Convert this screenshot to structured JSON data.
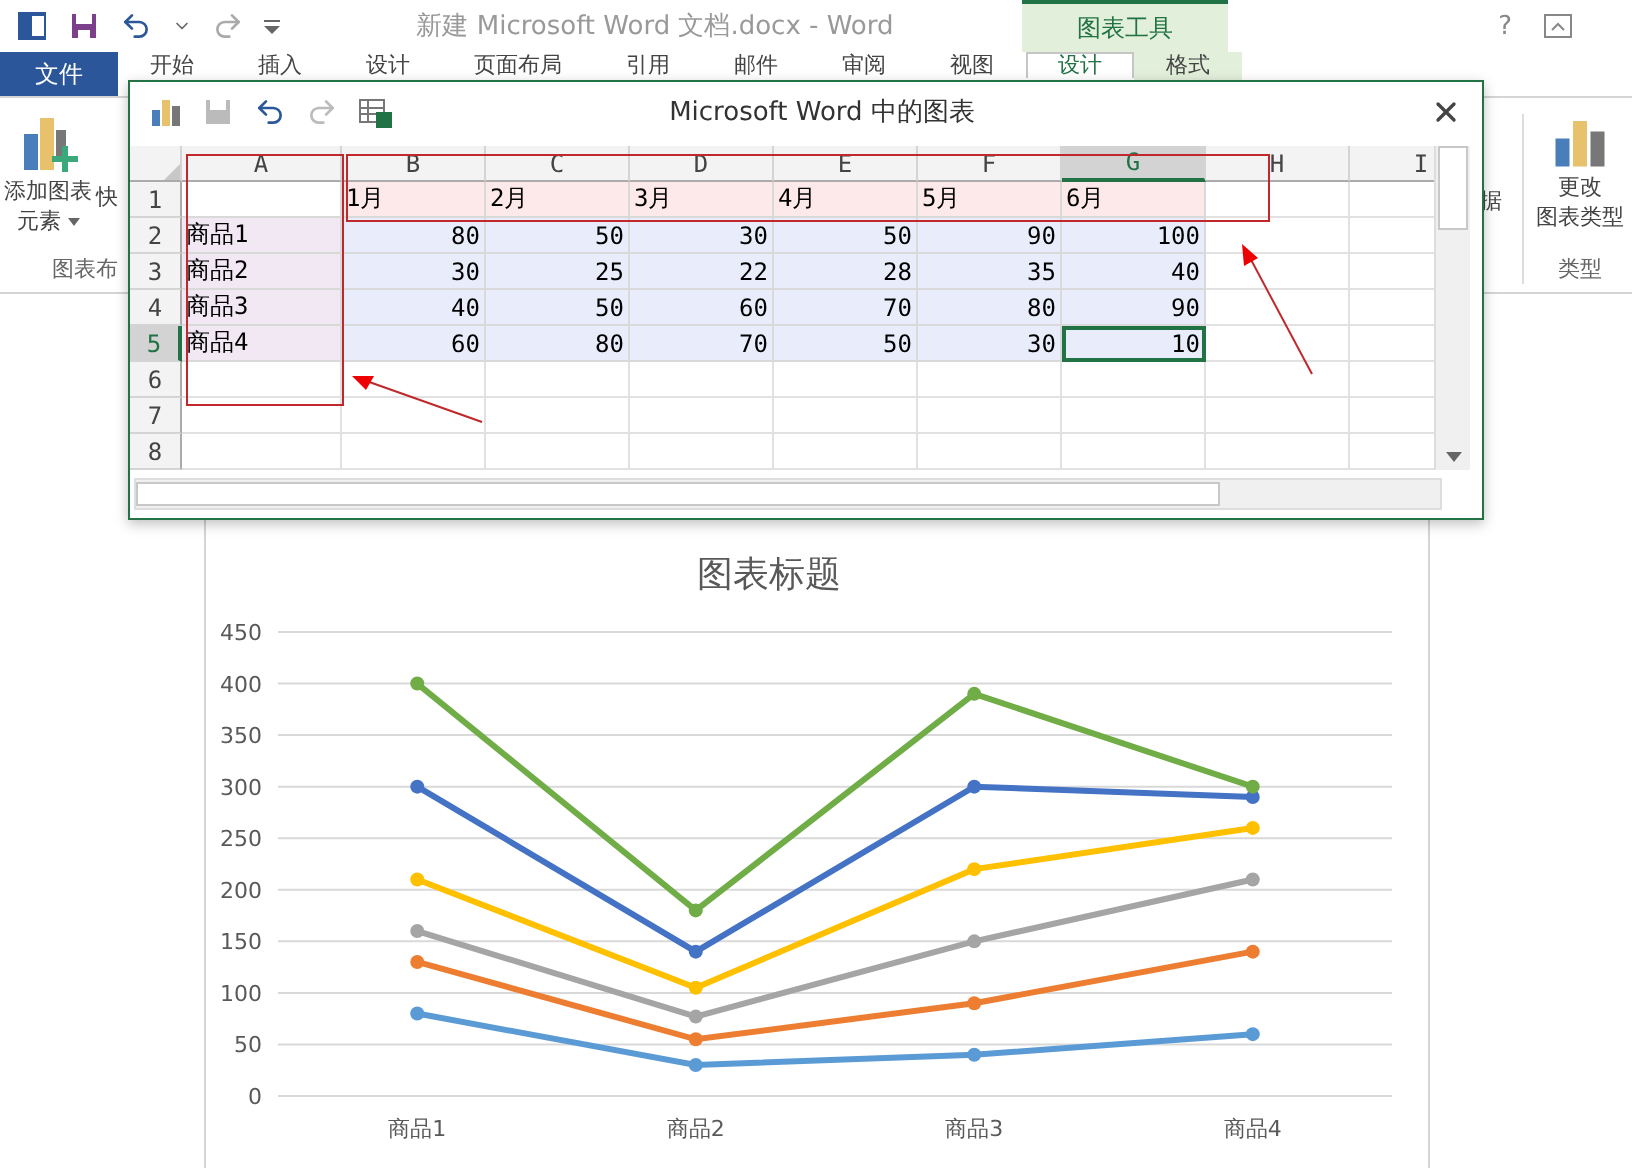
{
  "title_bar": {
    "title": "新建 Microsoft Word 文档.docx - Word",
    "tool_group": "图表工具",
    "help": "?"
  },
  "ribbon_tabs": [
    {
      "label": "文件",
      "kind": "file",
      "selected": false
    },
    {
      "label": "开始",
      "kind": "tab",
      "selected": false
    },
    {
      "label": "插入",
      "kind": "tab",
      "selected": false
    },
    {
      "label": "设计",
      "kind": "tab",
      "selected": false
    },
    {
      "label": "页面布局",
      "kind": "tab",
      "selected": false
    },
    {
      "label": "引用",
      "kind": "tab",
      "selected": false
    },
    {
      "label": "邮件",
      "kind": "tab",
      "selected": false
    },
    {
      "label": "审阅",
      "kind": "tab",
      "selected": false
    },
    {
      "label": "视图",
      "kind": "tab",
      "selected": false
    },
    {
      "label": "设计",
      "kind": "tool",
      "selected": true
    },
    {
      "label": "格式",
      "kind": "tool",
      "selected": false
    }
  ],
  "ribbon_left": {
    "button": [
      "添加图表",
      "元素"
    ],
    "cut_button": "快",
    "group": "图表布"
  },
  "ribbon_right": {
    "cut_label": "据",
    "button": [
      "更改",
      "图表类型"
    ],
    "group": "类型"
  },
  "data_window": {
    "title": "Microsoft Word 中的图表",
    "columns": [
      {
        "label": "A",
        "selected": false
      },
      {
        "label": "B",
        "selected": false
      },
      {
        "label": "C",
        "selected": false
      },
      {
        "label": "D",
        "selected": false
      },
      {
        "label": "E",
        "selected": false
      },
      {
        "label": "F",
        "selected": false
      },
      {
        "label": "G",
        "selected": true
      },
      {
        "label": "H",
        "selected": false
      },
      {
        "label": "I",
        "selected": false
      }
    ],
    "rows": [
      {
        "number": "1",
        "selected": false,
        "cells": [
          {
            "selected": false
          },
          {
            "text": "1月",
            "selected": false
          },
          {
            "text": "2月",
            "selected": false
          },
          {
            "text": "3月",
            "selected": false
          },
          {
            "text": "4月",
            "selected": false
          },
          {
            "text": "5月",
            "selected": false
          },
          {
            "text": "6月",
            "selected": false
          }
        ]
      },
      {
        "number": "2",
        "selected": false,
        "cells": [
          {
            "text": "商品1",
            "selected": false
          },
          {
            "text": "80",
            "selected": false
          },
          {
            "text": "50",
            "selected": false
          },
          {
            "text": "30",
            "selected": false
          },
          {
            "text": "50",
            "selected": false
          },
          {
            "text": "90",
            "selected": false
          },
          {
            "text": "100",
            "selected": false
          }
        ]
      },
      {
        "number": "3",
        "selected": false,
        "cells": [
          {
            "text": "商品2",
            "selected": false
          },
          {
            "text": "30",
            "selected": false
          },
          {
            "text": "25",
            "selected": false
          },
          {
            "text": "22",
            "selected": false
          },
          {
            "text": "28",
            "selected": false
          },
          {
            "text": "35",
            "selected": false
          },
          {
            "text": "40",
            "selected": false
          }
        ]
      },
      {
        "number": "4",
        "selected": false,
        "cells": [
          {
            "text": "商品3",
            "selected": false
          },
          {
            "text": "40",
            "selected": false
          },
          {
            "text": "50",
            "selected": false
          },
          {
            "text": "60",
            "selected": false
          },
          {
            "text": "70",
            "selected": false
          },
          {
            "text": "80",
            "selected": false
          },
          {
            "text": "90",
            "selected": false
          }
        ]
      },
      {
        "number": "5",
        "selected": true,
        "cells": [
          {
            "text": "商品4",
            "selected": false
          },
          {
            "text": "60",
            "selected": false
          },
          {
            "text": "80",
            "selected": false
          },
          {
            "text": "70",
            "selected": false
          },
          {
            "text": "50",
            "selected": false
          },
          {
            "text": "30",
            "selected": false
          },
          {
            "text": "10",
            "selected": true
          }
        ]
      },
      {
        "number": "6",
        "selected": false
      },
      {
        "number": "7",
        "selected": false
      },
      {
        "number": "8",
        "selected": false
      }
    ]
  },
  "chart": {
    "chart_data": {
      "type": "line",
      "title": "图表标题",
      "grid": true,
      "categories": [
        "商品1",
        "商品2",
        "商品3",
        "商品4"
      ],
      "series": [
        {
          "color": "#5b9bd5",
          "marker": "circle",
          "values": [
            80,
            30,
            40,
            60
          ]
        },
        {
          "color": "#ed7d31",
          "marker": "circle",
          "values": [
            130,
            55,
            90,
            140
          ]
        },
        {
          "color": "#a5a5a5",
          "marker": "circle",
          "values": [
            160,
            77,
            150,
            210
          ]
        },
        {
          "color": "#ffc000",
          "marker": "circle",
          "values": [
            210,
            105,
            220,
            260
          ]
        },
        {
          "color": "#4472c4",
          "marker": "circle",
          "values": [
            300,
            140,
            300,
            290
          ]
        },
        {
          "color": "#70ad47",
          "marker": "circle",
          "values": [
            400,
            180,
            390,
            300
          ]
        }
      ],
      "ylim": [
        0,
        450
      ],
      "yticks": [
        0,
        50,
        100,
        150,
        200,
        250,
        300,
        350,
        400,
        450
      ]
    }
  }
}
